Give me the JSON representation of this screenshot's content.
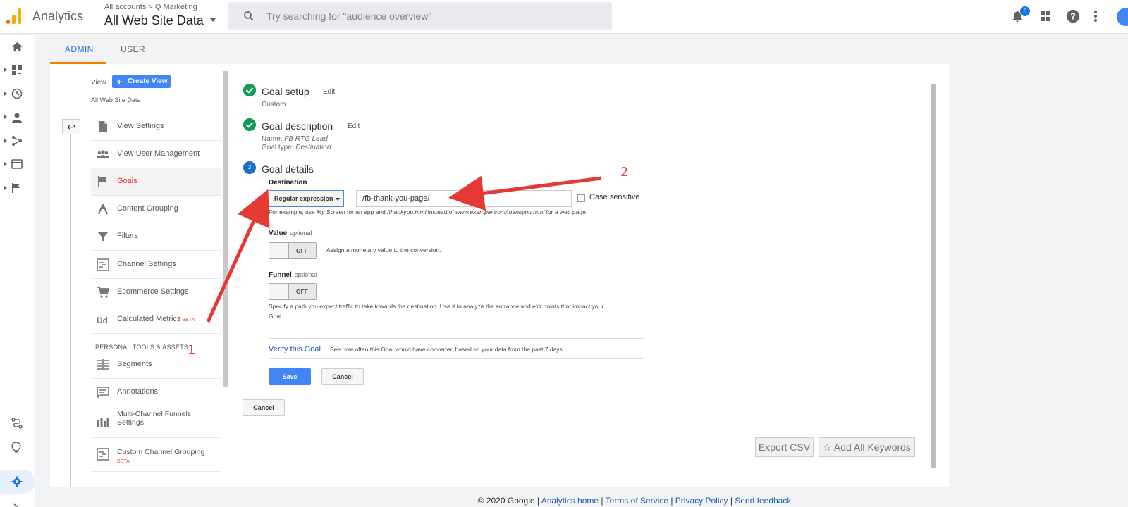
{
  "header": {
    "app_name": "Analytics",
    "account_crumb": "All accounts > Q Marketing",
    "view_name": "All Web Site Data",
    "search_placeholder": "Try searching for \"audience overview\"",
    "notification_count": "3"
  },
  "tabs": {
    "admin": "ADMIN",
    "user": "USER"
  },
  "view_column": {
    "label": "View",
    "create_view": "Create View",
    "view_name": "All Web Site Data",
    "items": [
      {
        "label": "View Settings",
        "icon": "document-icon"
      },
      {
        "label": "View User Management",
        "icon": "people-icon"
      },
      {
        "label": "Goals",
        "icon": "flag-icon"
      },
      {
        "label": "Content Grouping",
        "icon": "grouping-icon"
      },
      {
        "label": "Filters",
        "icon": "filter-icon"
      },
      {
        "label": "Channel Settings",
        "icon": "channel-icon"
      },
      {
        "label": "Ecommerce Settings",
        "icon": "cart-icon"
      },
      {
        "label": "Calculated Metrics",
        "icon": "dd-icon",
        "badge": "BETA"
      }
    ],
    "section_title": "PERSONAL TOOLS & ASSETS",
    "personal_items": [
      {
        "label": "Segments",
        "icon": "segments-icon"
      },
      {
        "label": "Annotations",
        "icon": "annotation-icon"
      },
      {
        "label": "Multi-Channel Funnels Settings",
        "icon": "bars-icon"
      },
      {
        "label": "Custom Channel Grouping",
        "icon": "channel-icon",
        "badge": "BETA"
      }
    ]
  },
  "goal": {
    "setup_title": "Goal setup",
    "setup_edit": "Edit",
    "setup_sub": "Custom",
    "desc_title": "Goal description",
    "desc_edit": "Edit",
    "desc_name_label": "Name:",
    "desc_name": "FB RTG Lead",
    "desc_type_label": "Goal type:",
    "desc_type": "Destination",
    "details_step": "3",
    "details_title": "Goal details",
    "destination_label": "Destination",
    "match_type": "Regular expression",
    "destination_value": "/fb-thank-you-page/",
    "case_sensitive": "Case sensitive",
    "hint_1": "For example, use ",
    "hint_2": "My Screen",
    "hint_3": " for an app and ",
    "hint_4": "/thankyou.html",
    "hint_5": " instead of ",
    "hint_6": "www.example.com/thankyou.html",
    "hint_7": " for a web page.",
    "value_label": "Value",
    "value_optional": "optional",
    "value_toggle": "OFF",
    "value_desc": "Assign a monetary value to the conversion.",
    "funnel_label": "Funnel",
    "funnel_optional": "optional",
    "funnel_toggle": "OFF",
    "funnel_desc_1": "Specify a path you expect traffic to take towards the destination. Use it to analyze the entrance and exit points that impact your",
    "funnel_desc_2": "Goal.",
    "verify_link": "Verify this Goal",
    "verify_desc": "See how often this Goal would have converted based on your data from the past 7 days.",
    "save": "Save",
    "cancel": "Cancel",
    "outer_cancel": "Cancel"
  },
  "table_actions": {
    "export_csv": "Export CSV",
    "add_keywords": "Add All Keywords"
  },
  "annotations": {
    "one": "1",
    "two": "2"
  },
  "footer": {
    "copyright": "© 2020 Google | ",
    "home": "Analytics home",
    "sep": " | ",
    "terms": "Terms of Service",
    "privacy": "Privacy Policy",
    "feedback": "Send feedback"
  },
  "colors": {
    "accent": "#1a73e8",
    "admin_underline": "#f57c00",
    "save_button": "#4285f4",
    "annotation": "#e53935",
    "check_green": "#0f9d58"
  }
}
